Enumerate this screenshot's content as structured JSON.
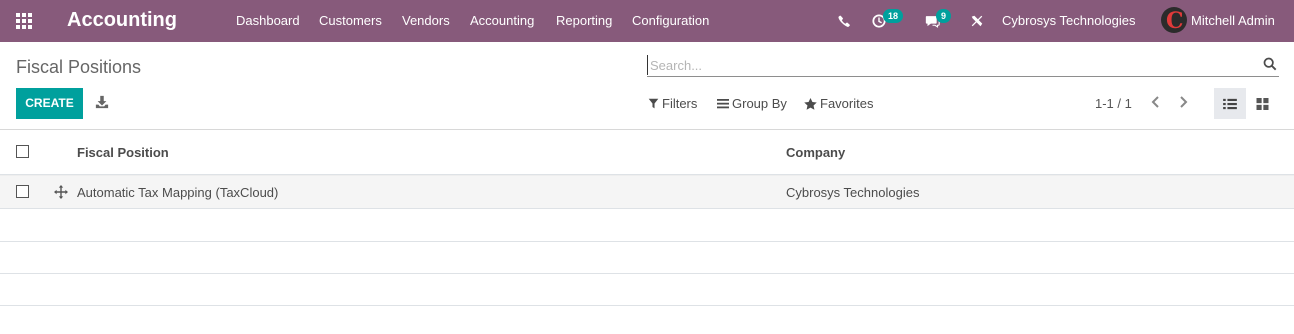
{
  "app": {
    "title": "Accounting",
    "menu": [
      "Dashboard",
      "Customers",
      "Vendors",
      "Accounting",
      "Reporting",
      "Configuration"
    ],
    "activities_count": "18",
    "messages_count": "9",
    "company": "Cybrosys Technologies",
    "user": "Mitchell Admin"
  },
  "control_panel": {
    "title": "Fiscal Positions",
    "search_placeholder": "Search...",
    "create_label": "CREATE",
    "filters_label": "Filters",
    "group_by_label": "Group By",
    "favorites_label": "Favorites",
    "pager": "1-1 / 1"
  },
  "table": {
    "columns": [
      "Fiscal Position",
      "Company"
    ],
    "rows": [
      {
        "fiscal_position": "Automatic Tax Mapping (TaxCloud)",
        "company": "Cybrosys Technologies"
      }
    ]
  },
  "colors": {
    "navbar": "#875a7b",
    "primary": "#00a09d"
  }
}
